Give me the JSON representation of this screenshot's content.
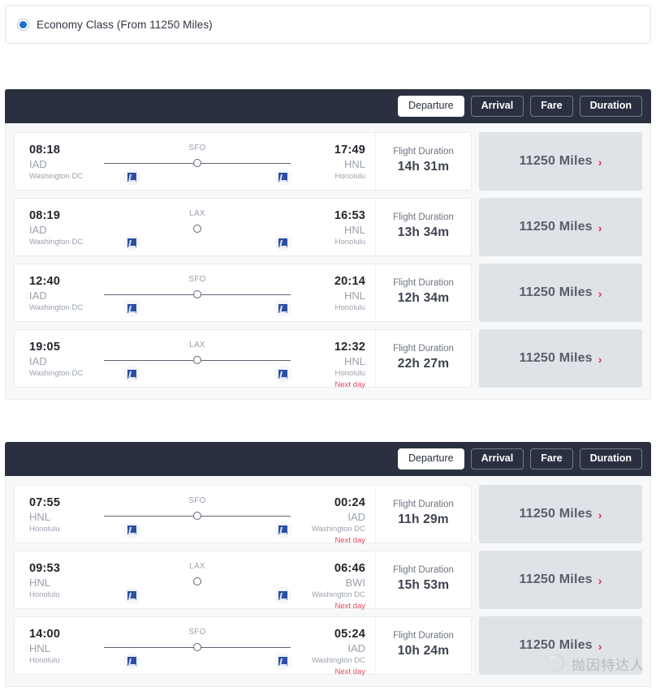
{
  "cabin": {
    "label": "Economy Class (From 11250 Miles)",
    "selected": true,
    "radio_icon": "radio-selected-icon",
    "accent_color": "#1a6fd4"
  },
  "sort_tabs": [
    {
      "label": "Departure",
      "active": true
    },
    {
      "label": "Arrival",
      "active": false
    },
    {
      "label": "Fare",
      "active": false
    },
    {
      "label": "Duration",
      "active": false
    }
  ],
  "colors": {
    "header_bar": "#2a3040",
    "miles_block": "#dfe3e7",
    "chevron": "#dc2f4b",
    "next_day": "#e1485f",
    "panel_bg": "#f7f8f9"
  },
  "labels": {
    "flight_duration": "Flight Duration",
    "next_day": "Next day",
    "chevron_icon": "chevron-right-icon",
    "airline_logo_icon": "airline-logo-icon"
  },
  "outbound": {
    "flights": [
      {
        "depart_time": "08:18",
        "depart_code": "IAD",
        "depart_city": "Washington DC",
        "depart_next_day": "",
        "stop_code": "SFO",
        "has_line": true,
        "arrive_time": "17:49",
        "arrive_code": "HNL",
        "arrive_city": "Honolulu",
        "arrive_next_day": "",
        "duration": "14h 31m",
        "miles": "11250 Miles"
      },
      {
        "depart_time": "08:19",
        "depart_code": "IAD",
        "depart_city": "Washington DC",
        "depart_next_day": "",
        "stop_code": "LAX",
        "has_line": false,
        "arrive_time": "16:53",
        "arrive_code": "HNL",
        "arrive_city": "Honolulu",
        "arrive_next_day": "",
        "duration": "13h 34m",
        "miles": "11250 Miles"
      },
      {
        "depart_time": "12:40",
        "depart_code": "IAD",
        "depart_city": "Washington DC",
        "depart_next_day": "",
        "stop_code": "SFO",
        "has_line": true,
        "arrive_time": "20:14",
        "arrive_code": "HNL",
        "arrive_city": "Honolulu",
        "arrive_next_day": "",
        "duration": "12h 34m",
        "miles": "11250 Miles"
      },
      {
        "depart_time": "19:05",
        "depart_code": "IAD",
        "depart_city": "Washington DC",
        "depart_next_day": "",
        "stop_code": "LAX",
        "has_line": true,
        "arrive_time": "12:32",
        "arrive_code": "HNL",
        "arrive_city": "Honolulu",
        "arrive_next_day": "Next day",
        "duration": "22h 27m",
        "miles": "11250 Miles"
      }
    ]
  },
  "inbound": {
    "flights": [
      {
        "depart_time": "07:55",
        "depart_code": "HNL",
        "depart_city": "Honolulu",
        "depart_next_day": "",
        "stop_code": "SFO",
        "has_line": true,
        "arrive_time": "00:24",
        "arrive_code": "IAD",
        "arrive_city": "Washington DC",
        "arrive_next_day": "Next day",
        "duration": "11h 29m",
        "miles": "11250 Miles"
      },
      {
        "depart_time": "09:53",
        "depart_code": "HNL",
        "depart_city": "Honolulu",
        "depart_next_day": "",
        "stop_code": "LAX",
        "has_line": false,
        "arrive_time": "06:46",
        "arrive_code": "BWI",
        "arrive_city": "Washington DC",
        "arrive_next_day": "Next day",
        "duration": "15h 53m",
        "miles": "11250 Miles"
      },
      {
        "depart_time": "14:00",
        "depart_code": "HNL",
        "depart_city": "Honolulu",
        "depart_next_day": "",
        "stop_code": "SFO",
        "has_line": true,
        "arrive_time": "05:24",
        "arrive_code": "IAD",
        "arrive_city": "Washington DC",
        "arrive_next_day": "Next day",
        "duration": "10h 24m",
        "miles": "11250 Miles"
      }
    ]
  },
  "watermark": {
    "logo_icon": "wechat-icon",
    "text": "抛因特达人"
  }
}
